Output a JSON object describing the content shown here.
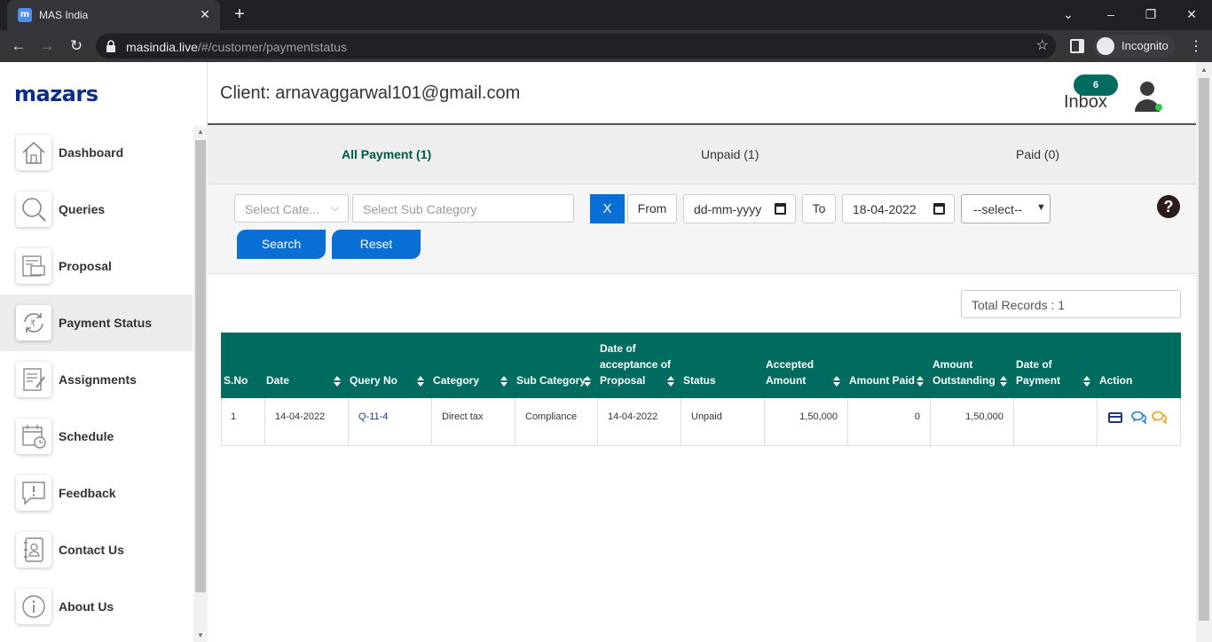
{
  "browser": {
    "tab_title": "MAS India",
    "favicon_letter": "m",
    "close_glyph": "✕",
    "newtab_glyph": "+",
    "url_domain": "masindia.live",
    "url_path": "/#/customer/paymentstatus",
    "incognito_label": "Incognito"
  },
  "sidebar": {
    "logo": "mazars",
    "items": [
      {
        "label": "Dashboard",
        "icon": "home-icon"
      },
      {
        "label": "Queries",
        "icon": "search-icon"
      },
      {
        "label": "Proposal",
        "icon": "proposal-icon"
      },
      {
        "label": "Payment Status",
        "icon": "rupee-refresh-icon"
      },
      {
        "label": "Assignments",
        "icon": "assignment-icon"
      },
      {
        "label": "Schedule",
        "icon": "calendar-icon"
      },
      {
        "label": "Feedback",
        "icon": "feedback-icon"
      },
      {
        "label": "Contact Us",
        "icon": "contact-icon"
      },
      {
        "label": "About Us",
        "icon": "info-icon"
      }
    ],
    "active_index": 3
  },
  "header": {
    "client": "Client: arnavaggarwal101@gmail.com",
    "inbox_count": "6",
    "inbox_label": "Inbox"
  },
  "tabs": {
    "all": "All Payment (1)",
    "unpaid": "Unpaid (1)",
    "paid": "Paid (0)"
  },
  "filters": {
    "category_placeholder": "Select Cate...",
    "subcategory_placeholder": "Select Sub Category",
    "clear_label": "X",
    "from_label": "From",
    "from_value": "dd-mm-yyyy",
    "to_label": "To",
    "to_value": "18-04-2022",
    "status_select": "--select--",
    "search_label": "Search",
    "reset_label": "Reset",
    "help_glyph": "?"
  },
  "total_records": "Total Records : 1",
  "table": {
    "headers": [
      "S.No",
      "Date",
      "Query No",
      "Category",
      "Sub Category",
      "Date of acceptance of Proposal",
      "Status",
      "Accepted Amount",
      "Amount Paid",
      "Amount Outstanding",
      "Date of Payment",
      "Action"
    ],
    "rows": [
      {
        "sno": "1",
        "date": "14-04-2022",
        "query_no": "Q-11-4",
        "category": "Direct tax",
        "sub_category": "Compliance",
        "date_acceptance": "14-04-2022",
        "status": "Unpaid",
        "accepted_amount": "1,50,000",
        "amount_paid": "0",
        "amount_outstanding": "1,50,000",
        "date_of_payment": ""
      }
    ]
  },
  "colors": {
    "accent_green": "#006b5f",
    "button_blue": "#0a6fd4",
    "logo_blue": "#0b2e8a"
  }
}
